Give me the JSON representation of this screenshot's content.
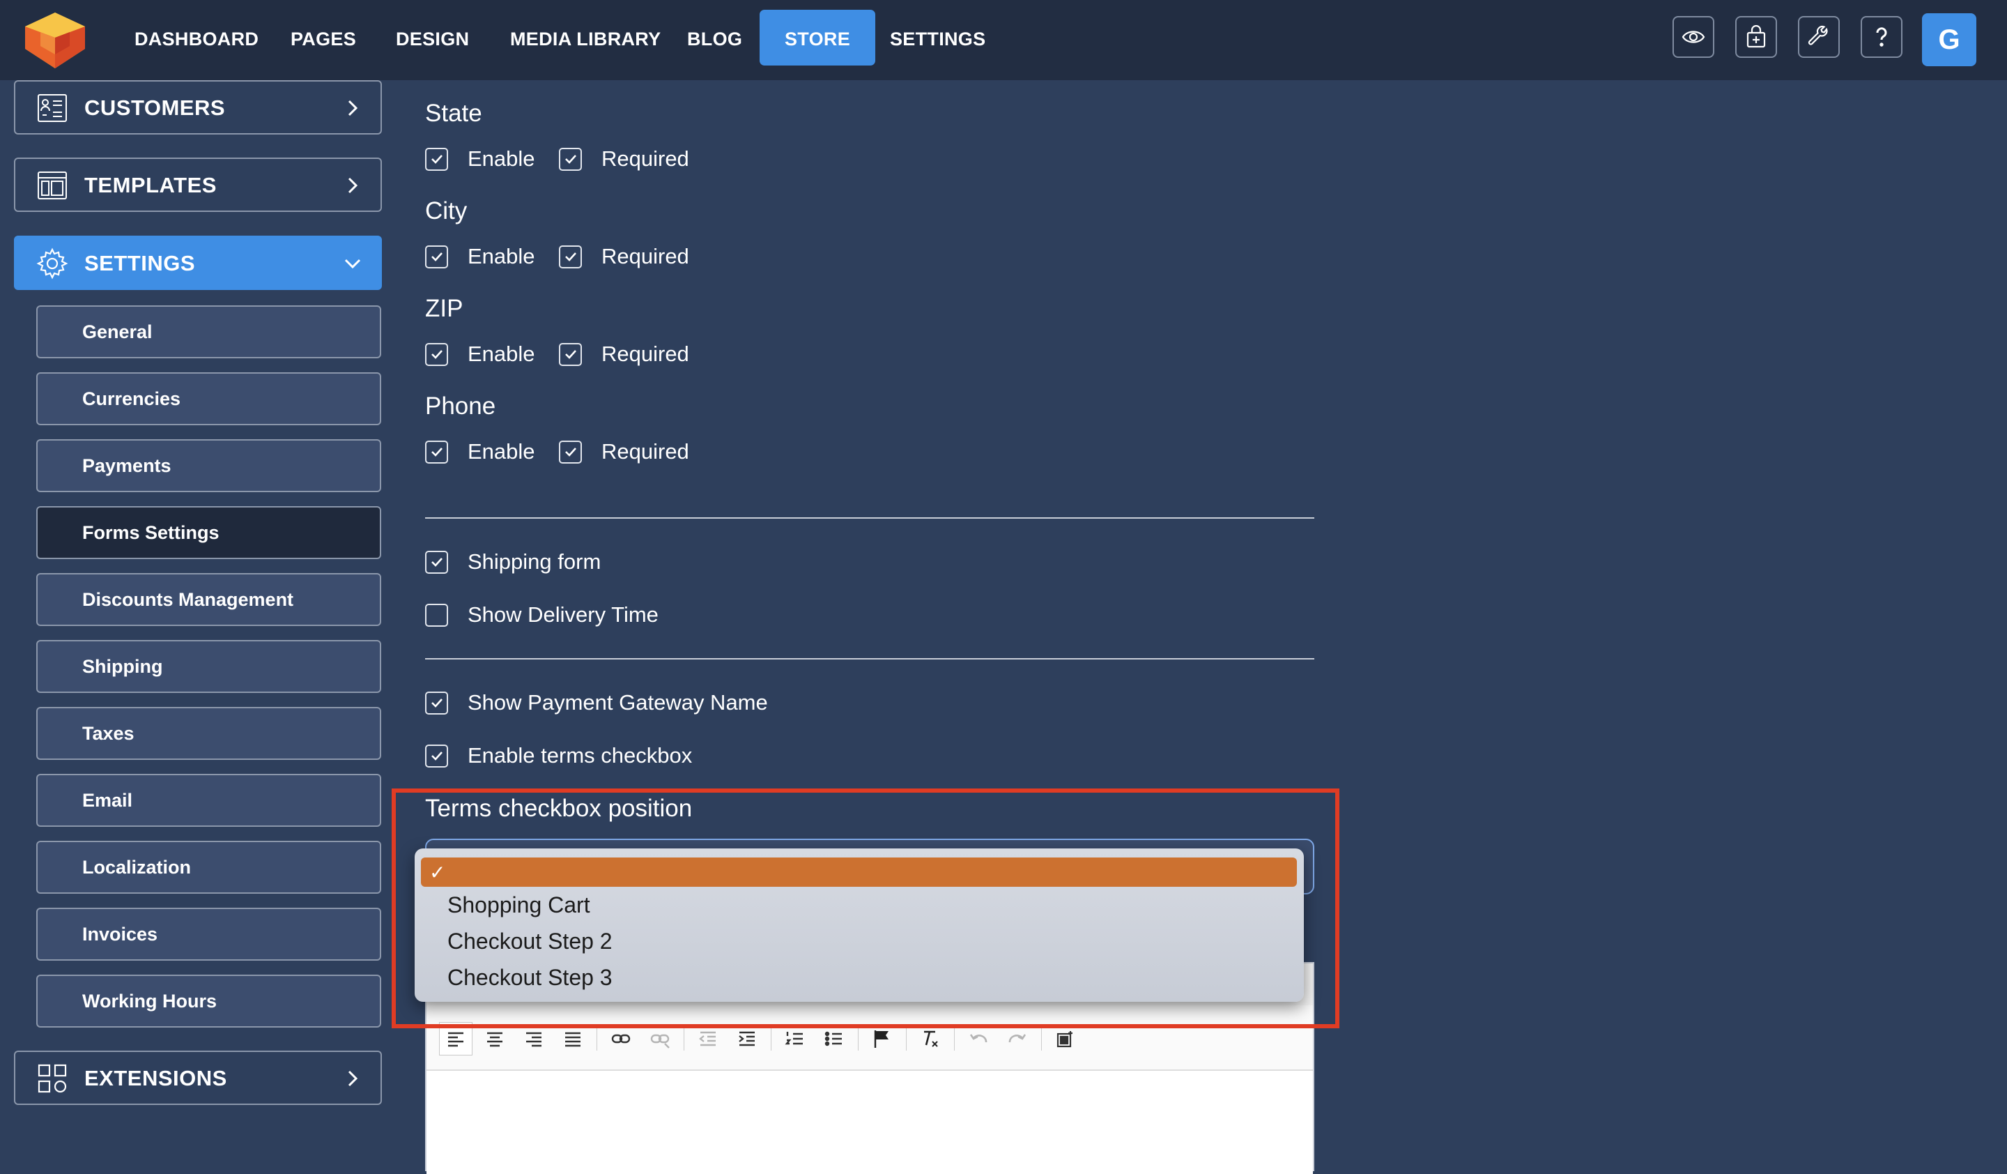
{
  "topnav": {
    "items": [
      {
        "label": "DASHBOARD",
        "active": false
      },
      {
        "label": "PAGES",
        "active": false
      },
      {
        "label": "DESIGN",
        "active": false
      },
      {
        "label": "MEDIA LIBRARY",
        "active": false
      },
      {
        "label": "BLOG",
        "active": false
      },
      {
        "label": "STORE",
        "active": true
      },
      {
        "label": "SETTINGS",
        "active": false
      }
    ],
    "icons": [
      "eye-icon",
      "store-bag-icon",
      "wrench-icon",
      "help-icon"
    ],
    "avatar_letter": "G",
    "accent_color": "#3f8ee4"
  },
  "sidebar": {
    "sections": {
      "customers": "CUSTOMERS",
      "templates": "TEMPLATES",
      "settings": "SETTINGS",
      "extensions": "EXTENSIONS"
    },
    "settings_items": [
      {
        "label": "General",
        "active": false
      },
      {
        "label": "Currencies",
        "active": false
      },
      {
        "label": "Payments",
        "active": false
      },
      {
        "label": "Forms Settings",
        "active": true
      },
      {
        "label": "Discounts Management",
        "active": false
      },
      {
        "label": "Shipping",
        "active": false
      },
      {
        "label": "Taxes",
        "active": false
      },
      {
        "label": "Email",
        "active": false
      },
      {
        "label": "Localization",
        "active": false
      },
      {
        "label": "Invoices",
        "active": false
      },
      {
        "label": "Working Hours",
        "active": false
      }
    ]
  },
  "form": {
    "fields": [
      {
        "title": "State",
        "enable": true,
        "required": true
      },
      {
        "title": "City",
        "enable": true,
        "required": true
      },
      {
        "title": "ZIP",
        "enable": true,
        "required": true
      },
      {
        "title": "Phone",
        "enable": true,
        "required": true
      }
    ],
    "enable_label": "Enable",
    "required_label": "Required",
    "shipping_form": {
      "label": "Shipping form",
      "checked": true
    },
    "show_delivery_time": {
      "label": "Show Delivery Time",
      "checked": false
    },
    "show_payment_gateway": {
      "label": "Show Payment Gateway Name",
      "checked": true
    },
    "enable_terms": {
      "label": "Enable terms checkbox",
      "checked": true
    },
    "terms_position": {
      "label": "Terms checkbox position",
      "selected": "",
      "options": [
        "",
        "Shopping Cart",
        "Checkout Step 2",
        "Checkout Step 3"
      ]
    }
  },
  "colors": {
    "highlight": "#e03c24",
    "selected_option": "#cc7130"
  }
}
